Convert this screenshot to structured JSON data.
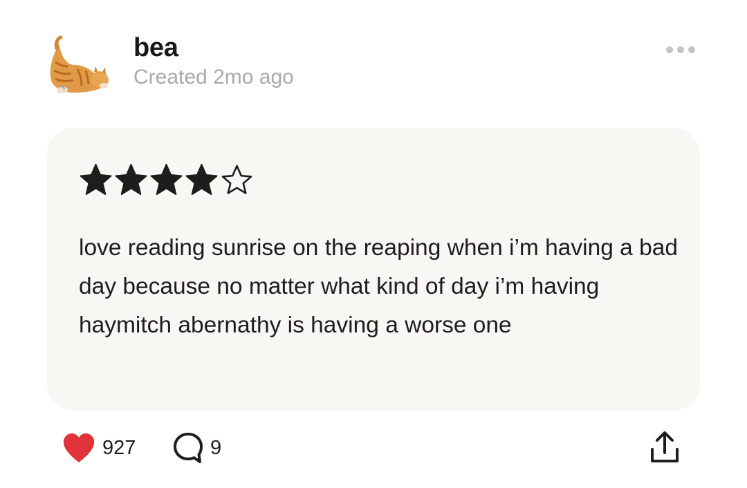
{
  "post": {
    "author": "bea",
    "created": "Created 2mo ago",
    "avatar_icon": "cat-avatar"
  },
  "review": {
    "rating": 4,
    "max_rating": 5,
    "text": "love reading sunrise on the reaping when i’m having a bad day because no matter what kind of day i’m having haymitch abernathy is having a worse one"
  },
  "actions": {
    "like_count": "927",
    "comment_count": "9",
    "like_icon": "heart-icon",
    "comment_icon": "comment-icon",
    "share_icon": "share-icon",
    "more_icon": "more-icon"
  },
  "colors": {
    "card_background": "#f9f7f3",
    "heart": "#e0343a",
    "text": "#1f1c1e",
    "muted": "#a9a9ab"
  }
}
